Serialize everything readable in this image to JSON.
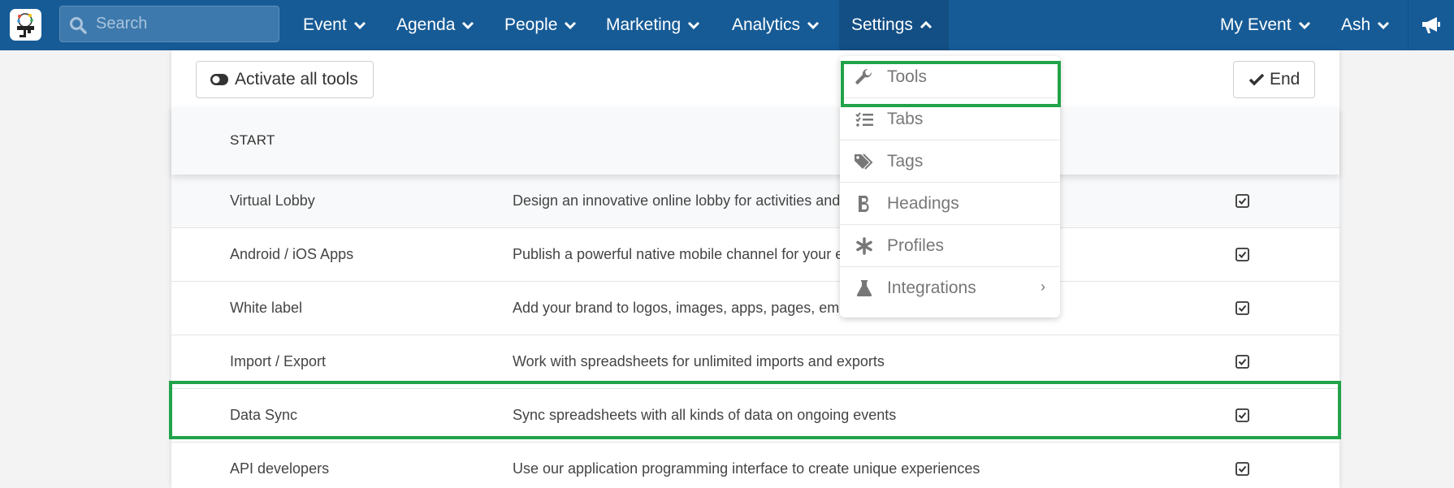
{
  "search": {
    "placeholder": "Search"
  },
  "nav": {
    "items": [
      {
        "label": "Event"
      },
      {
        "label": "Agenda"
      },
      {
        "label": "People"
      },
      {
        "label": "Marketing"
      },
      {
        "label": "Analytics"
      },
      {
        "label": "Settings"
      }
    ],
    "right": [
      {
        "label": "My Event"
      },
      {
        "label": "Ash"
      }
    ]
  },
  "toolbar": {
    "activate_label": "Activate all tools",
    "end_label": "End"
  },
  "section": {
    "start_label": "START"
  },
  "rows": [
    {
      "name": "Virtual Lobby",
      "desc": "Design an innovative online lobby for activities and",
      "checked": true
    },
    {
      "name": "Android / iOS Apps",
      "desc": "Publish a powerful native mobile channel for your e",
      "checked": true
    },
    {
      "name": "White label",
      "desc": "Add your brand to logos, images, apps, pages, email",
      "checked": true
    },
    {
      "name": "Import / Export",
      "desc": "Work with spreadsheets for unlimited imports and exports",
      "checked": true
    },
    {
      "name": "Data Sync",
      "desc": "Sync spreadsheets with all kinds of data on ongoing events",
      "checked": true
    },
    {
      "name": "API developers",
      "desc": "Use our application programming interface to create unique experiences",
      "checked": true
    }
  ],
  "settings_menu": [
    {
      "label": "Tools",
      "icon": "wrench-icon"
    },
    {
      "label": "Tabs",
      "icon": "list-check-icon"
    },
    {
      "label": "Tags",
      "icon": "tags-icon"
    },
    {
      "label": "Headings",
      "icon": "bold-icon"
    },
    {
      "label": "Profiles",
      "icon": "asterisk-icon"
    },
    {
      "label": "Integrations",
      "icon": "flask-icon",
      "submenu": true
    }
  ],
  "colors": {
    "nav_bg": "#165b96",
    "highlight": "#21a349"
  }
}
